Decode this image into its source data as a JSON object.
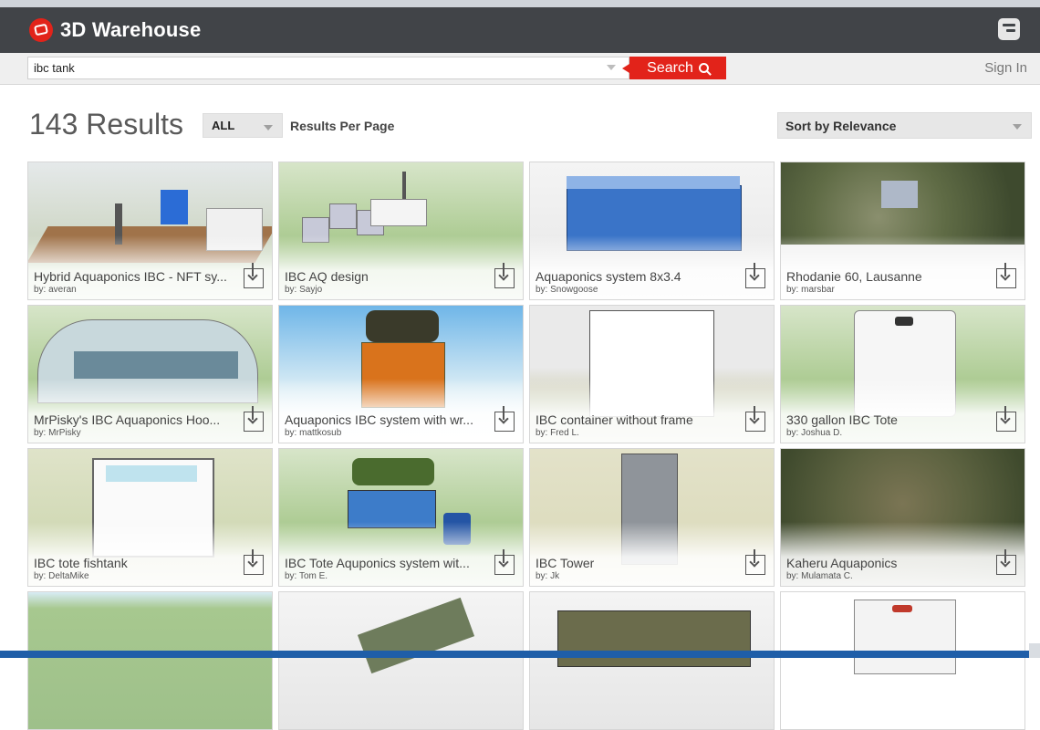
{
  "app": {
    "brand": "3D Warehouse",
    "accent": "#e2231a",
    "header_bg": "#414448"
  },
  "search": {
    "value": "ibc tank",
    "button_label": "Search",
    "sign_in": "Sign In"
  },
  "results": {
    "count_label": "143 Results",
    "filter_value": "ALL",
    "per_page_label": "Results Per Page",
    "sort_value": "Sort by Relevance"
  },
  "cards": [
    {
      "title": "Hybrid Aquaponics IBC - NFT sy...",
      "author": "by: averan"
    },
    {
      "title": "IBC AQ design",
      "author": "by: Sayjo"
    },
    {
      "title": "Aquaponics system 8x3.4",
      "author": "by: Snowgoose"
    },
    {
      "title": "Rhodanie 60, Lausanne",
      "author": "by: marsbar"
    },
    {
      "title": "MrPisky's IBC Aquaponics Hoo...",
      "author": "by: MrPisky"
    },
    {
      "title": "Aquaponics IBC system with wr...",
      "author": "by: mattkosub"
    },
    {
      "title": "IBC container without frame",
      "author": "by: Fred L."
    },
    {
      "title": "330 gallon IBC Tote",
      "author": "by: Joshua D."
    },
    {
      "title": "IBC tote fishtank",
      "author": "by: DeltaMike"
    },
    {
      "title": "IBC Tote Aquponics system wit...",
      "author": "by: Tom E."
    },
    {
      "title": "IBC Tower",
      "author": "by: Jk"
    },
    {
      "title": "Kaheru Aquaponics",
      "author": "by: Mulamata C."
    },
    {
      "title": "",
      "author": ""
    },
    {
      "title": "",
      "author": ""
    },
    {
      "title": "",
      "author": ""
    },
    {
      "title": "",
      "author": ""
    }
  ]
}
